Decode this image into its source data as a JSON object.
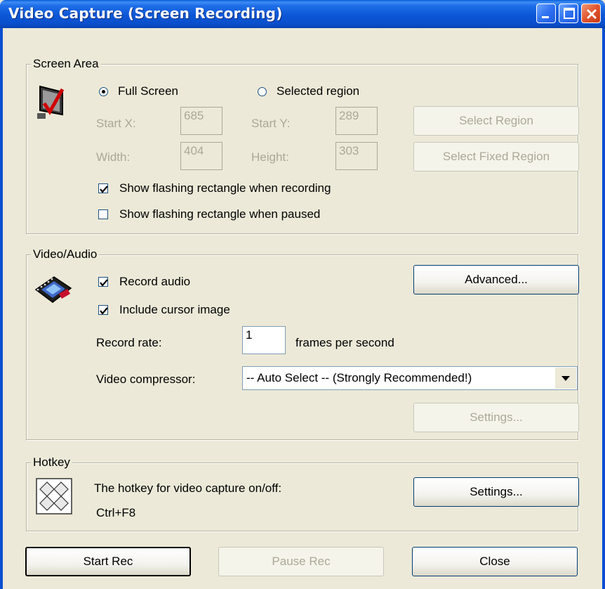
{
  "window": {
    "title": "Video Capture (Screen Recording)"
  },
  "screen_area": {
    "group_label": "Screen Area",
    "radio_full_screen": "Full Screen",
    "radio_selected_region": "Selected region",
    "start_x_label": "Start X:",
    "start_x_value": "685",
    "start_y_label": "Start Y:",
    "start_y_value": "289",
    "width_label": "Width:",
    "width_value": "404",
    "height_label": "Height:",
    "height_value": "303",
    "select_region_button": "Select Region",
    "select_fixed_region_button": "Select Fixed Region",
    "show_flash_recording": "Show flashing rectangle when recording",
    "show_flash_paused": "Show flashing rectangle when paused",
    "show_flash_recording_checked": true,
    "show_flash_paused_checked": false
  },
  "video_audio": {
    "group_label": "Video/Audio",
    "record_audio": "Record audio",
    "include_cursor": "Include cursor image",
    "advanced_button": "Advanced...",
    "record_rate_label": "Record rate:",
    "record_rate_value": "1",
    "fps_label": "frames per second",
    "compressor_label": "Video compressor:",
    "compressor_value": "-- Auto Select -- (Strongly Recommended!)",
    "settings_button": "Settings..."
  },
  "hotkey": {
    "group_label": "Hotkey",
    "description": "The hotkey for video capture on/off:",
    "value": "Ctrl+F8",
    "settings_button": "Settings..."
  },
  "footer": {
    "start_rec": "Start Rec",
    "pause_rec": "Pause Rec",
    "close": "Close"
  }
}
